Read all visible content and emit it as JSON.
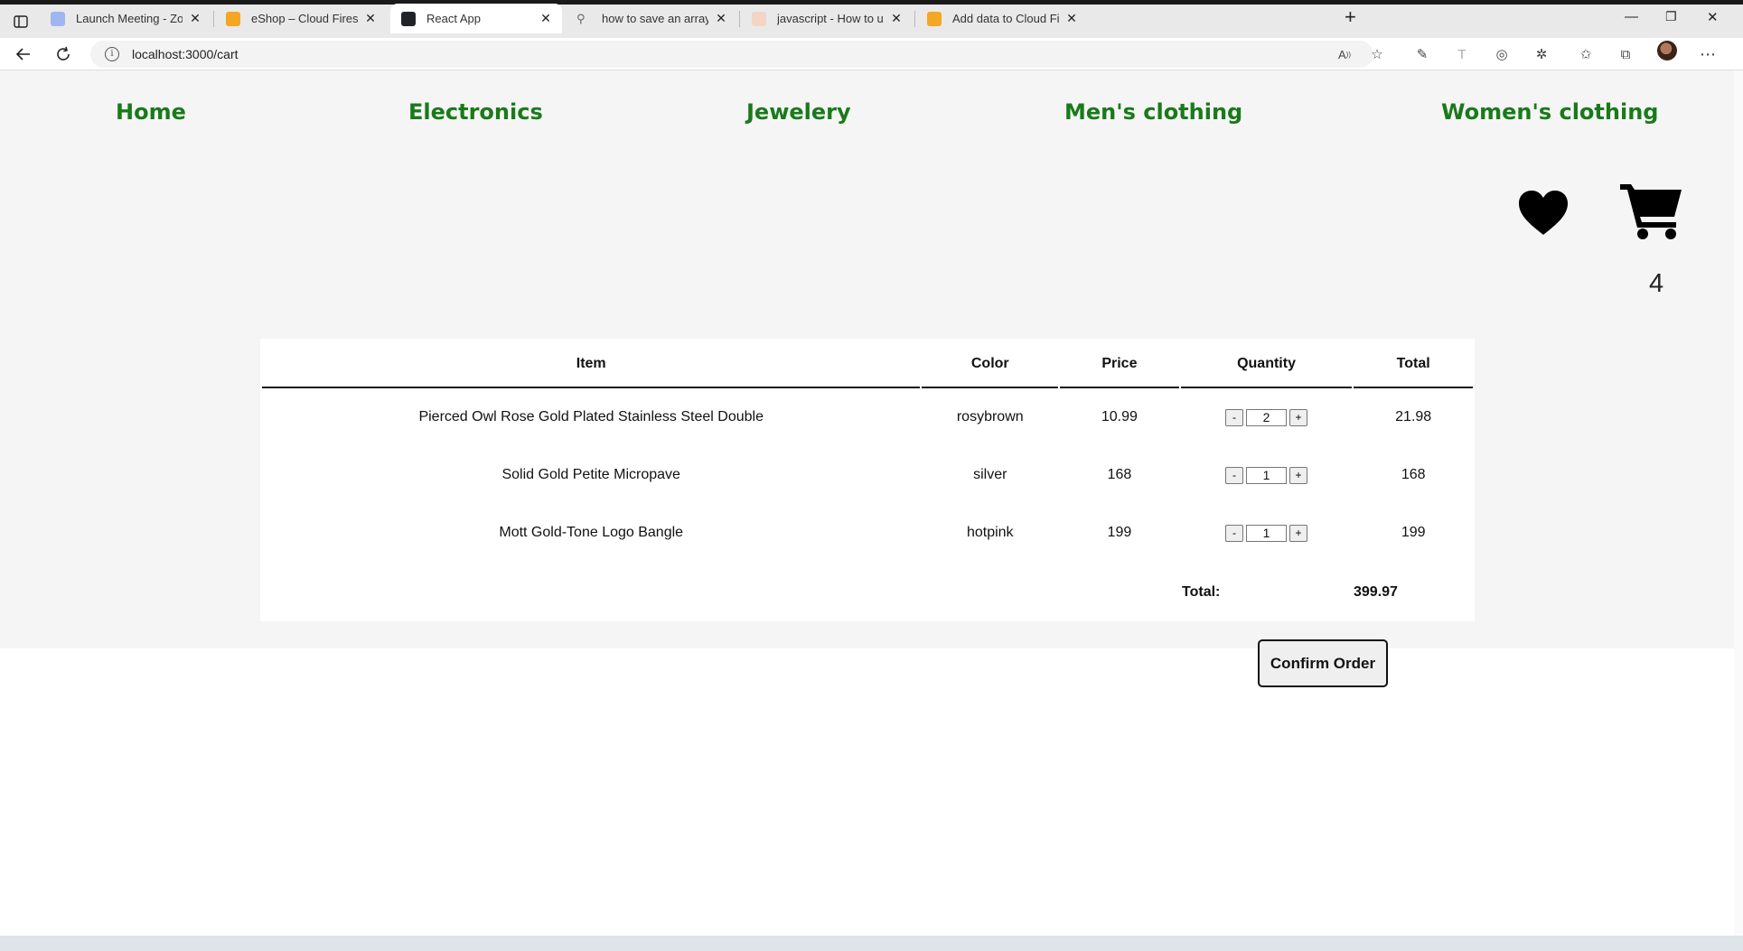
{
  "browser": {
    "tabs": [
      {
        "title": "Launch Meeting - Zoom",
        "icon": "zoom-icon",
        "active": false
      },
      {
        "title": "eShop – Cloud Firestore – Fireba",
        "icon": "firebase-icon",
        "active": false
      },
      {
        "title": "React App",
        "icon": "react-icon",
        "active": true
      },
      {
        "title": "how to save an array of object in",
        "icon": "search-icon",
        "active": false
      },
      {
        "title": "javascript - How to update an \"a",
        "icon": "stackoverflow-icon",
        "active": false
      },
      {
        "title": "Add data to Cloud Firestore | F",
        "icon": "firebase-icon",
        "active": false
      }
    ],
    "url": "localhost:3000/cart"
  },
  "nav": {
    "links": [
      "Home",
      "Electronics",
      "Jewelery",
      "Men's clothing",
      "Women's clothing"
    ],
    "color": "#1a7a1a"
  },
  "header_icons": {
    "wishlist": "heart-icon",
    "cart": "cart-icon",
    "cart_count": "4"
  },
  "cart": {
    "columns": [
      "Item",
      "Color",
      "Price",
      "Quantity",
      "Total"
    ],
    "rows": [
      {
        "item": "Pierced Owl Rose Gold Plated Stainless Steel Double",
        "color": "rosybrown",
        "price": "10.99",
        "qty": "2",
        "total": "21.98"
      },
      {
        "item": "Solid Gold Petite Micropave",
        "color": "silver",
        "price": "168",
        "qty": "1",
        "total": "168"
      },
      {
        "item": "Mott Gold-Tone Logo Bangle",
        "color": "hotpink",
        "price": "199",
        "qty": "1",
        "total": "199"
      }
    ],
    "minus_label": "-",
    "plus_label": "+",
    "total_label": "Total:",
    "total_value": "399.97",
    "confirm_label": "Confirm Order"
  }
}
